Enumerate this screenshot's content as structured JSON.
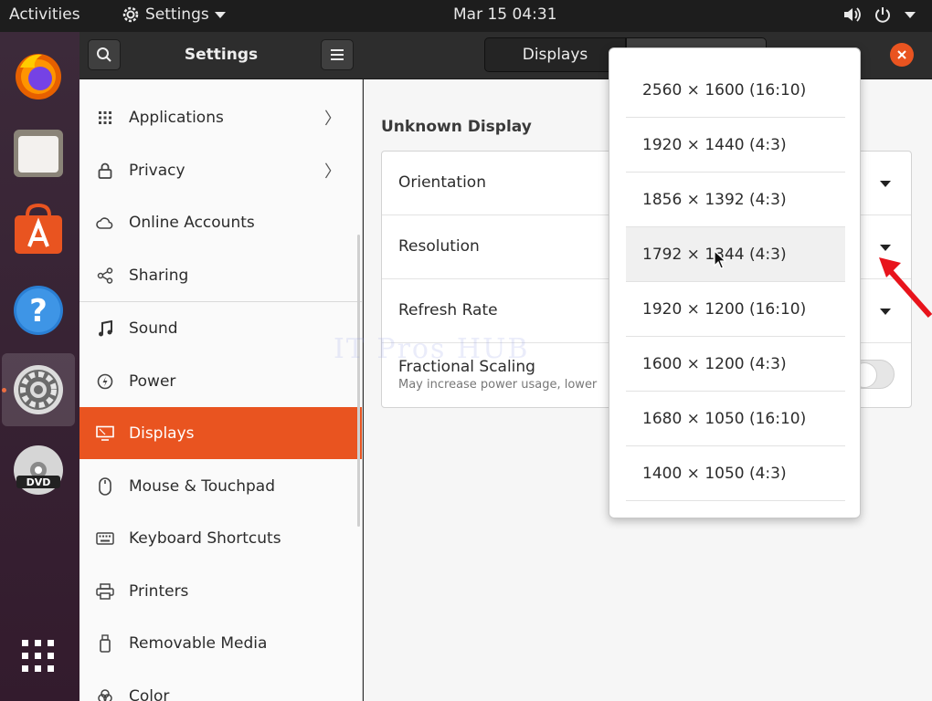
{
  "topbar": {
    "activities": "Activities",
    "app_menu": "Settings",
    "clock": "Mar 15  04:31"
  },
  "dock": {
    "items": [
      "firefox-icon",
      "files-icon",
      "software-icon",
      "help-icon",
      "settings-icon",
      "dvd-icon"
    ],
    "apps_grid": "show-applications-icon"
  },
  "sidebar_header": {
    "title": "Settings"
  },
  "main_header": {
    "tab": "Displays"
  },
  "sidebar": {
    "items": [
      {
        "label": "Applications",
        "icon": "grid-icon",
        "chevron": "〉"
      },
      {
        "label": "Privacy",
        "icon": "lock-icon",
        "chevron": "〉"
      },
      {
        "label": "Online Accounts",
        "icon": "cloud-icon"
      },
      {
        "label": "Sharing",
        "icon": "share-icon"
      },
      {
        "label": "Sound",
        "icon": "music-note-icon"
      },
      {
        "label": "Power",
        "icon": "power-icon"
      },
      {
        "label": "Displays",
        "icon": "display-icon",
        "selected": true
      },
      {
        "label": "Mouse & Touchpad",
        "icon": "mouse-icon"
      },
      {
        "label": "Keyboard Shortcuts",
        "icon": "keyboard-icon"
      },
      {
        "label": "Printers",
        "icon": "printer-icon"
      },
      {
        "label": "Removable Media",
        "icon": "usb-icon"
      },
      {
        "label": "Color",
        "icon": "color-icon"
      }
    ]
  },
  "display": {
    "title": "Unknown Display",
    "orientation_label": "Orientation",
    "resolution_label": "Resolution",
    "refresh_label": "Refresh Rate",
    "fractional_label": "Fractional Scaling",
    "fractional_sub": "May increase power usage, lower"
  },
  "watermark": "IT Pros HUB",
  "resolution_options": [
    "2560 × 1600 (16:10)",
    "1920 × 1440 (4:3)",
    "1856 × 1392 (4:3)",
    "1792 × 1344 (4:3)",
    "1920 × 1200 (16:10)",
    "1600 × 1200 (4:3)",
    "1680 × 1050 (16:10)",
    "1400 × 1050 (4:3)"
  ],
  "hovered_option_index": 3,
  "colors": {
    "accent": "#e95420",
    "annotation": "#e8141c"
  }
}
